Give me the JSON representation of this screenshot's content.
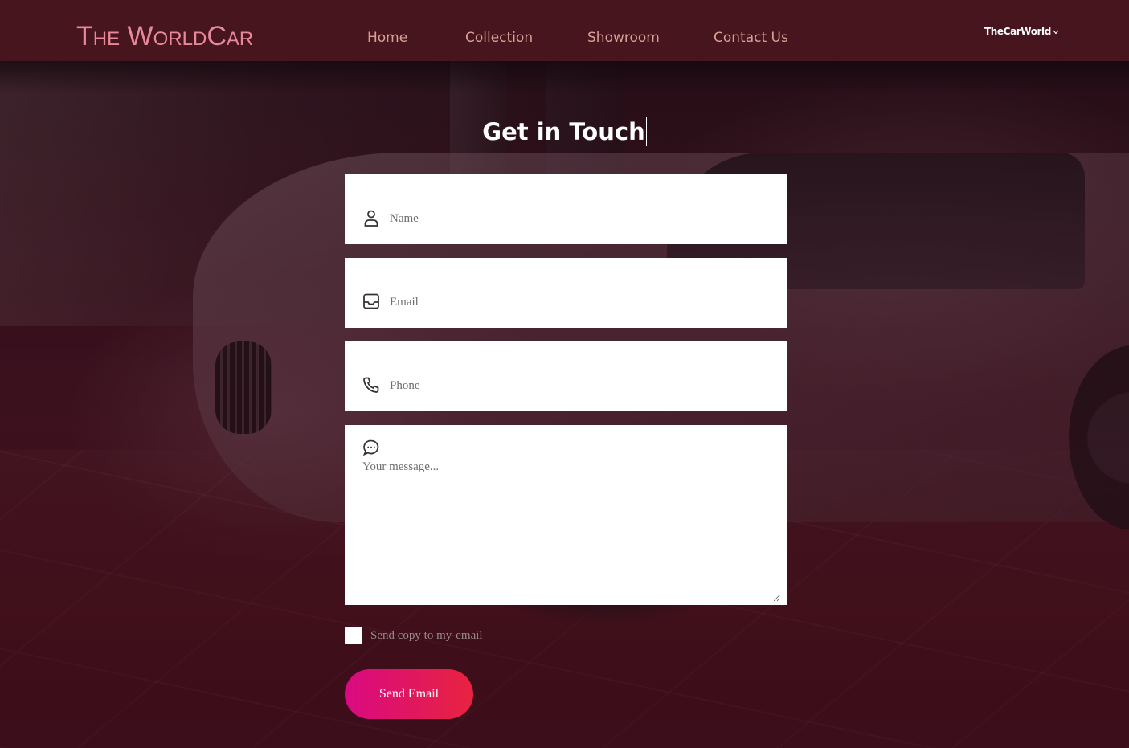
{
  "header": {
    "logo": "The WorldCar",
    "nav": [
      {
        "label": "Home"
      },
      {
        "label": "Collection"
      },
      {
        "label": "Showroom"
      },
      {
        "label": "Contact Us"
      }
    ],
    "account_label": "TheCarWorld",
    "account_icon": "chevron-down-icon"
  },
  "main": {
    "title": "Get in Touch",
    "fields": {
      "name": {
        "placeholder": "Name",
        "icon": "user-icon"
      },
      "email": {
        "placeholder": "Email",
        "icon": "inbox-icon"
      },
      "phone": {
        "placeholder": "Phone",
        "icon": "phone-icon"
      },
      "message": {
        "placeholder": "Your message...",
        "icon": "chat-bubble-icon"
      }
    },
    "copy_label": "Send copy to my-email",
    "send_label": "Send Email"
  },
  "colors": {
    "header_bg": "#4a1620",
    "logo": "#e8889a",
    "nav_text": "#d9a097",
    "button_start": "#d90a82",
    "button_end": "#e8233f"
  }
}
